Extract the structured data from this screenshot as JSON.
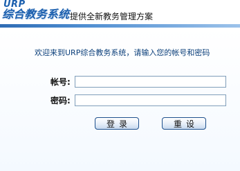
{
  "header": {
    "logo_brand": "URP",
    "logo_name": "综合教务系统",
    "slogan": "提供全新教务管理方案"
  },
  "login": {
    "welcome": "欢迎来到URP综合教务系统，请输入您的帐号和密码",
    "account_label": "帐号:",
    "account_value": "",
    "password_label": "密码:",
    "password_value": "",
    "login_button": "登录",
    "reset_button": "重设"
  },
  "colors": {
    "brand_blue": "#1b5fae",
    "welcome_text": "#0b3f7a",
    "header_rule": "#2f6cb4",
    "field_border": "#7f9db9"
  }
}
